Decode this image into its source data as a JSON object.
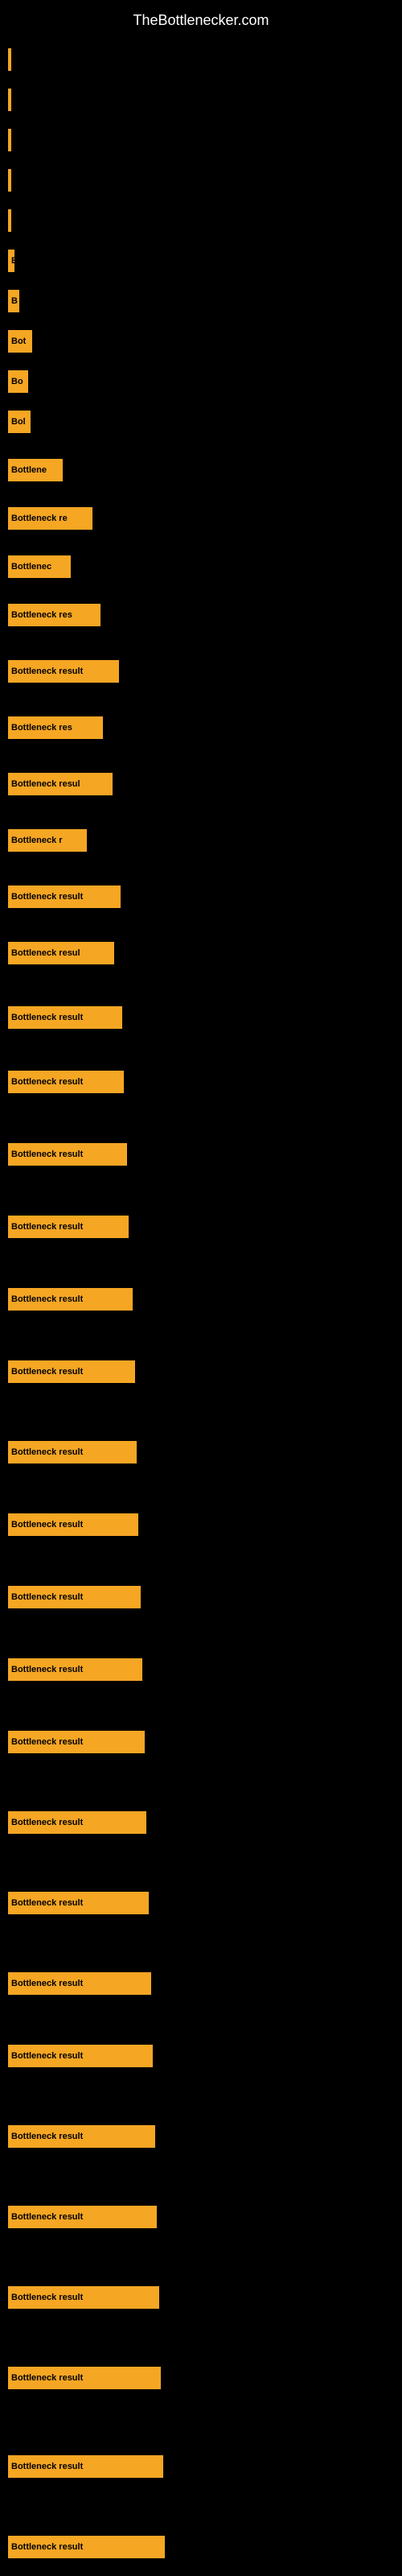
{
  "site": {
    "title": "TheBottlenecker.com"
  },
  "bars": [
    {
      "label": "|",
      "width": 2
    },
    {
      "label": "",
      "width": 2
    },
    {
      "label": "|",
      "width": 2
    },
    {
      "label": "",
      "width": 2
    },
    {
      "label": "|",
      "width": 2
    },
    {
      "label": "",
      "width": 2
    },
    {
      "label": "|",
      "width": 2
    },
    {
      "label": "",
      "width": 2
    },
    {
      "label": "|",
      "width": 2
    },
    {
      "label": "",
      "width": 2
    },
    {
      "label": "E",
      "width": 8
    },
    {
      "label": "",
      "width": 2
    },
    {
      "label": "B",
      "width": 14
    },
    {
      "label": "",
      "width": 2
    },
    {
      "label": "Bot",
      "width": 30
    },
    {
      "label": "",
      "width": 2
    },
    {
      "label": "Bo",
      "width": 25
    },
    {
      "label": "",
      "width": 2
    },
    {
      "label": "Bol",
      "width": 28
    },
    {
      "label": "",
      "width": 2
    },
    {
      "label": "Bottlene",
      "width": 68
    },
    {
      "label": "",
      "width": 2
    },
    {
      "label": "Bottleneck re",
      "width": 105
    },
    {
      "label": "",
      "width": 2
    },
    {
      "label": "Bottlenec",
      "width": 78
    },
    {
      "label": "",
      "width": 2
    },
    {
      "label": "Bottleneck res",
      "width": 115
    },
    {
      "label": "",
      "width": 2
    },
    {
      "label": "Bottleneck result",
      "width": 138
    },
    {
      "label": "",
      "width": 2
    },
    {
      "label": "Bottleneck res",
      "width": 118
    },
    {
      "label": "",
      "width": 2
    },
    {
      "label": "Bottleneck resul",
      "width": 130
    },
    {
      "label": "",
      "width": 2
    },
    {
      "label": "Bottleneck r",
      "width": 98
    },
    {
      "label": "",
      "width": 2
    },
    {
      "label": "Bottleneck result",
      "width": 140
    },
    {
      "label": "",
      "width": 2
    },
    {
      "label": "Bottleneck resul",
      "width": 132
    },
    {
      "label": "",
      "width": 2
    },
    {
      "label": "Bottleneck result",
      "width": 142
    },
    {
      "label": "",
      "width": 2
    },
    {
      "label": "Bottleneck result",
      "width": 144
    },
    {
      "label": "",
      "width": 2
    },
    {
      "label": "Bottleneck result",
      "width": 148
    },
    {
      "label": "",
      "width": 2
    },
    {
      "label": "Bottleneck result",
      "width": 150
    },
    {
      "label": "",
      "width": 2
    },
    {
      "label": "Bottleneck result",
      "width": 155
    },
    {
      "label": "",
      "width": 2
    },
    {
      "label": "Bottleneck result",
      "width": 158
    },
    {
      "label": "",
      "width": 2
    },
    {
      "label": "Bottleneck result",
      "width": 160
    },
    {
      "label": "",
      "width": 2
    },
    {
      "label": "Bottleneck result",
      "width": 162
    },
    {
      "label": "",
      "width": 2
    },
    {
      "label": "Bottleneck result",
      "width": 165
    },
    {
      "label": "",
      "width": 2
    },
    {
      "label": "Bottleneck result",
      "width": 167
    },
    {
      "label": "",
      "width": 2
    },
    {
      "label": "Bottleneck result",
      "width": 170
    },
    {
      "label": "",
      "width": 2
    },
    {
      "label": "Bottleneck result",
      "width": 172
    },
    {
      "label": "",
      "width": 2
    },
    {
      "label": "Bottleneck result",
      "width": 175
    },
    {
      "label": "",
      "width": 2
    },
    {
      "label": "Bottleneck result",
      "width": 178
    }
  ]
}
